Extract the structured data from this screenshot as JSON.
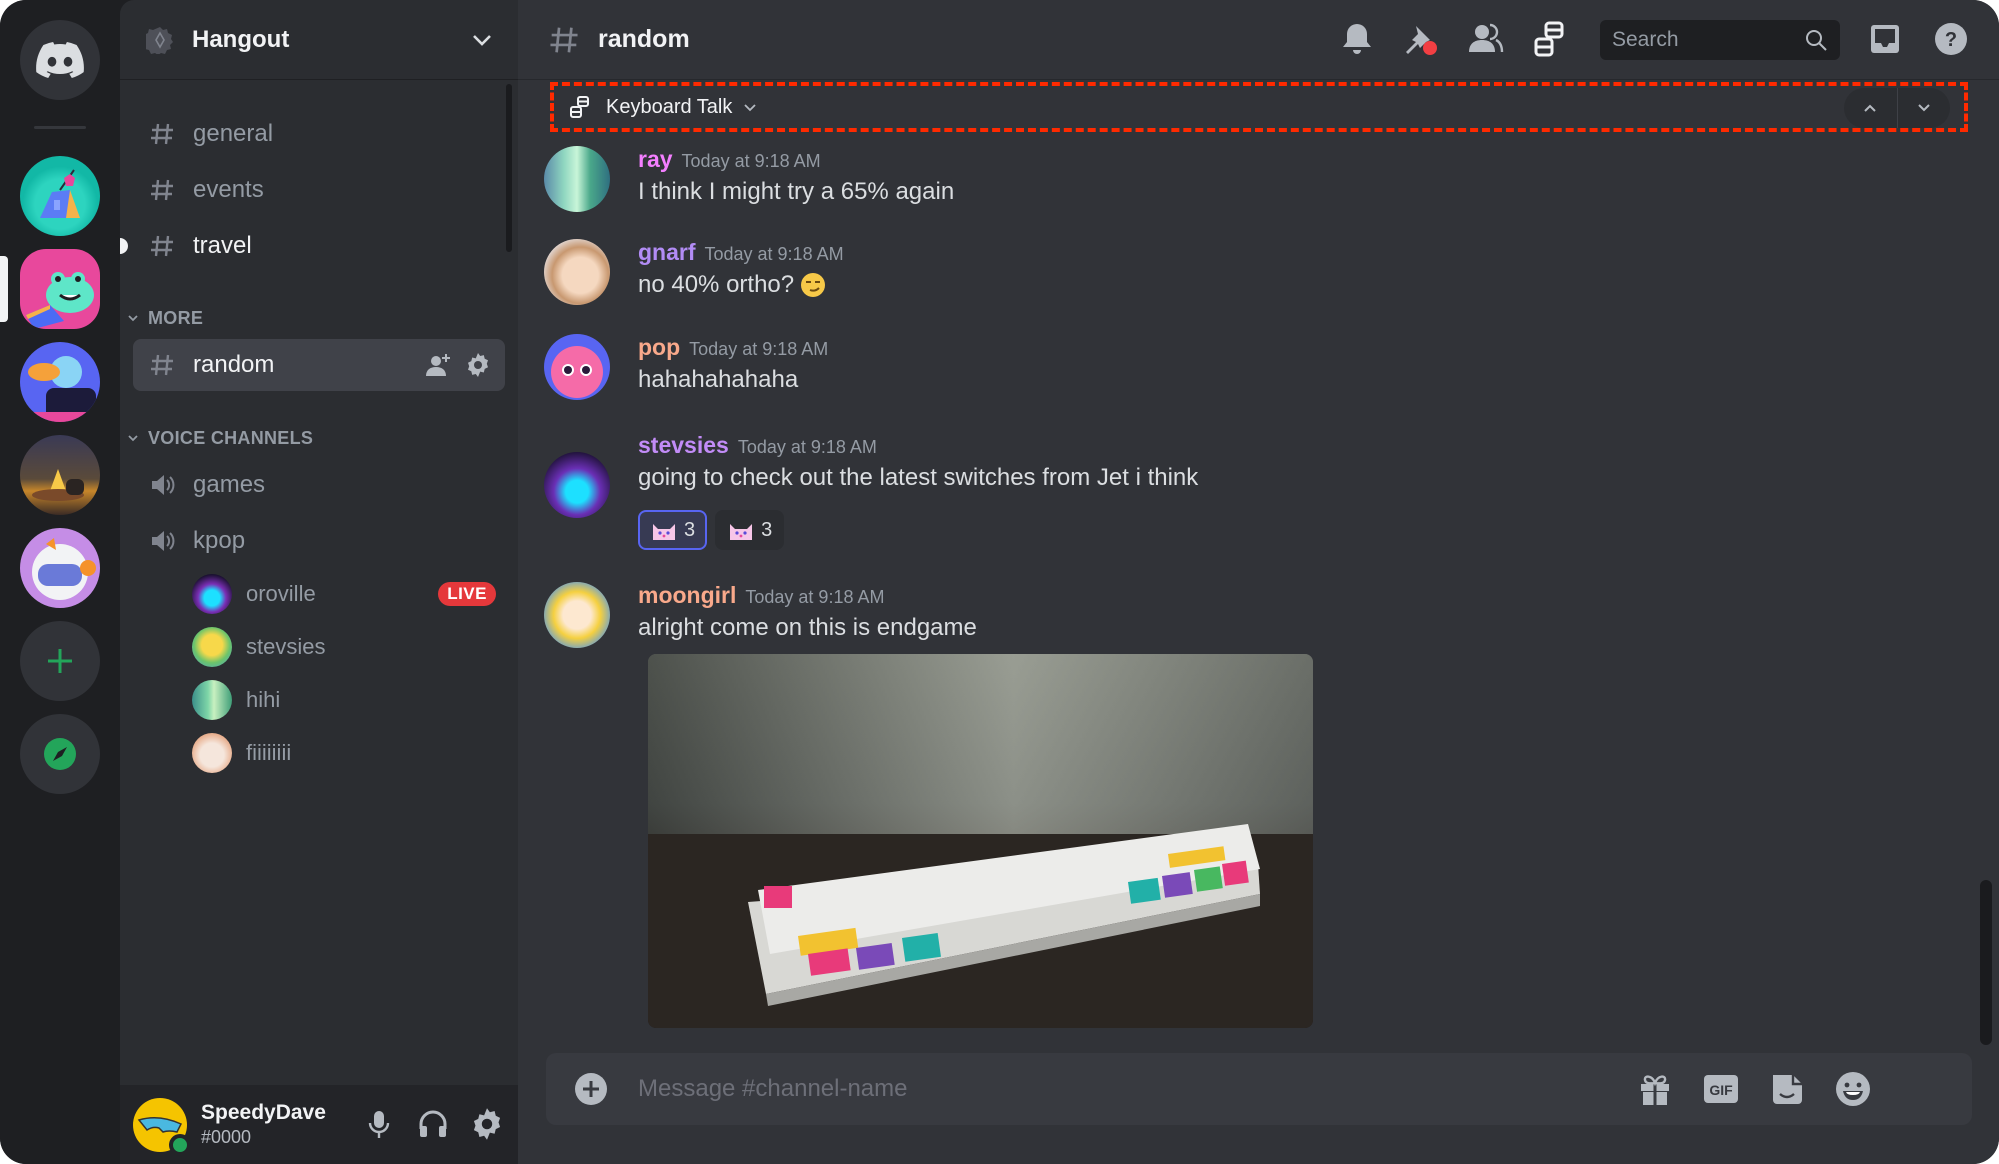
{
  "server_rail": {
    "home": {
      "icon": "discord-logo-icon"
    },
    "servers": [
      {
        "name": "crystal-tent-server",
        "active": false
      },
      {
        "name": "frog-reading-server",
        "active": true
      },
      {
        "name": "blue-creature-server",
        "active": false
      },
      {
        "name": "campfire-server",
        "active": false
      },
      {
        "name": "astronaut-server",
        "active": false
      }
    ],
    "add_server": {
      "icon": "plus-icon"
    },
    "explore": {
      "icon": "compass-icon"
    }
  },
  "sidebar": {
    "guild_name": "Hangout",
    "channels": [
      {
        "name": "general",
        "type": "text"
      },
      {
        "name": "events",
        "type": "text"
      },
      {
        "name": "travel",
        "type": "text",
        "unread": true
      }
    ],
    "categories": [
      {
        "name": "MORE",
        "channels": [
          {
            "name": "random",
            "type": "text",
            "active": true
          }
        ]
      },
      {
        "name": "VOICE CHANNELS",
        "channels": [
          {
            "name": "games",
            "type": "voice"
          },
          {
            "name": "kpop",
            "type": "voice",
            "users": [
              {
                "name": "oroville",
                "badge": "LIVE"
              },
              {
                "name": "stevsies"
              },
              {
                "name": "hihi"
              },
              {
                "name": "fiiiiiiii"
              }
            ]
          }
        ]
      }
    ],
    "user": {
      "name": "SpeedyDave",
      "tag": "#0000",
      "status": "online"
    }
  },
  "header": {
    "channel_name": "random",
    "search_placeholder": "Search"
  },
  "thread_bar": {
    "name": "Keyboard Talk"
  },
  "messages": [
    {
      "author": "ray",
      "color": "#f47fff",
      "time": "Today at 9:18 AM",
      "text": "I think I might try a 65% again"
    },
    {
      "author": "gnarf",
      "color": "#b28cf5",
      "time": "Today at 9:18 AM",
      "text": "no 40% ortho?",
      "emoji": "smirk"
    },
    {
      "author": "pop",
      "color": "#f9a98b",
      "time": "Today at 9:18 AM",
      "text": "hahahahahaha"
    },
    {
      "author": "stevsies",
      "color": "#c28cf7",
      "time": "Today at 9:18 AM",
      "text": "going to check out the latest switches from Jet i think",
      "reactions": [
        {
          "emoji": "cat",
          "count": "3",
          "me": true
        },
        {
          "emoji": "cat",
          "count": "3",
          "me": false
        }
      ]
    },
    {
      "author": "moongirl",
      "color": "#f9a98b",
      "time": "Today at 9:18 AM",
      "text": "alright come on this is endgame",
      "attachment": "keyboard-photo"
    }
  ],
  "composer": {
    "placeholder": "Message #channel-name"
  },
  "colors": {
    "accent": "#5865f2",
    "online": "#23a55a",
    "live": "#e5383b",
    "annotation": "#ff2a00"
  }
}
